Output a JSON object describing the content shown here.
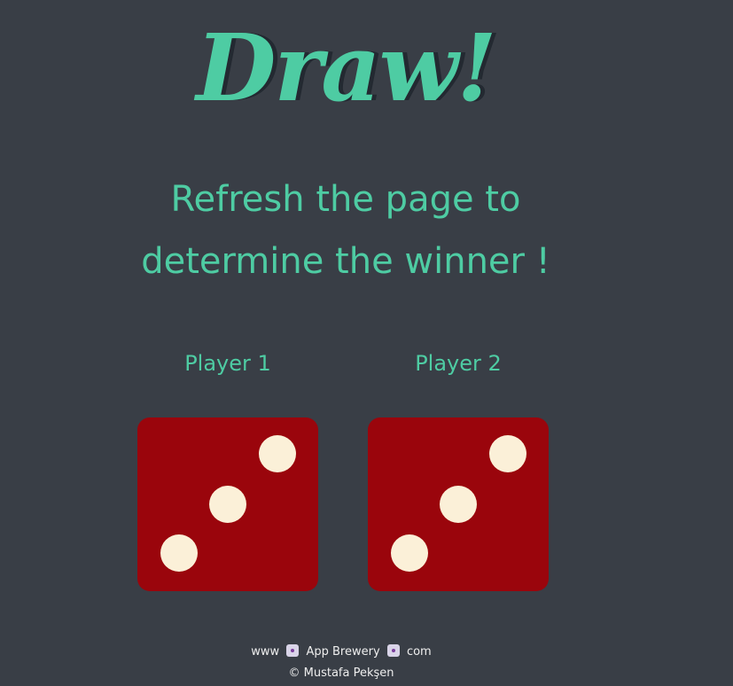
{
  "header": {
    "title": "Draw!",
    "subtitle_line1": "Refresh the page to",
    "subtitle_line2": "determine the winner !"
  },
  "players": [
    {
      "label": "Player 1",
      "die_value": 3
    },
    {
      "label": "Player 2",
      "die_value": 3
    }
  ],
  "footer": {
    "prefix": "www",
    "brand": "App Brewery",
    "suffix": "com",
    "dice_icon": "game-die-icon",
    "credit": "© Mustafa Pekşen"
  },
  "colors": {
    "background": "#393e46",
    "accent": "#4ecca3",
    "die_face": "#9a050c",
    "pip": "#fbf0d8",
    "title_shadow": "#232931"
  }
}
